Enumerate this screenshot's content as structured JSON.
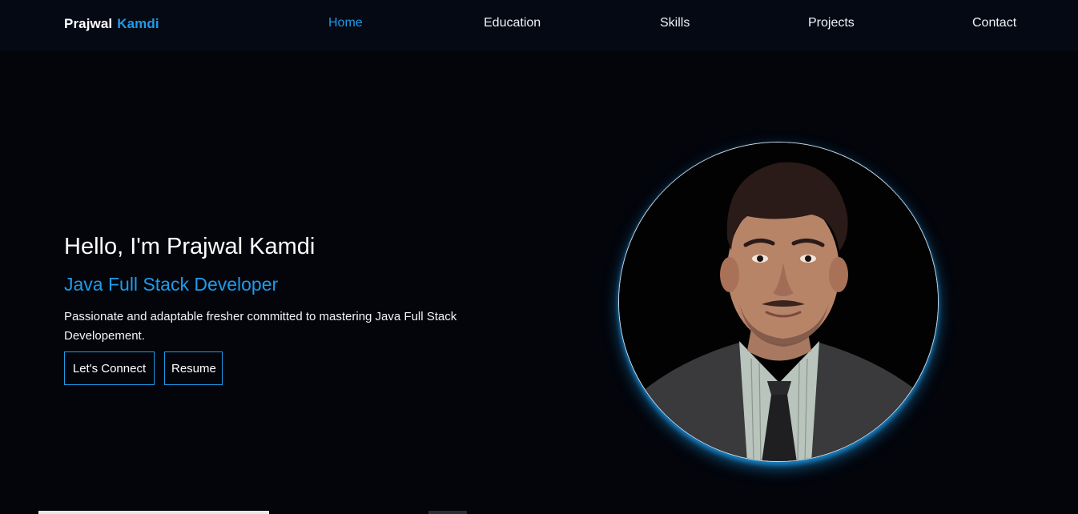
{
  "brand": {
    "first": "Prajwal",
    "last": "Kamdi"
  },
  "nav": {
    "items": [
      {
        "label": "Home",
        "active": true
      },
      {
        "label": "Education",
        "active": false
      },
      {
        "label": "Skills",
        "active": false
      },
      {
        "label": "Projects",
        "active": false
      },
      {
        "label": "Contact",
        "active": false
      }
    ]
  },
  "hero": {
    "title": "Hello, I'm Prajwal Kamdi",
    "role": "Java Full Stack Developer",
    "description": "Passionate and adaptable fresher committed to mastering Java Full Stack Developement.",
    "buttons": {
      "connect": "Let's Connect",
      "resume": "Resume"
    }
  },
  "colors": {
    "accent": "#1e9bea",
    "background": "#03050b",
    "navbar": "#050914"
  },
  "icons": {
    "profile_photo": "profile-portrait"
  }
}
